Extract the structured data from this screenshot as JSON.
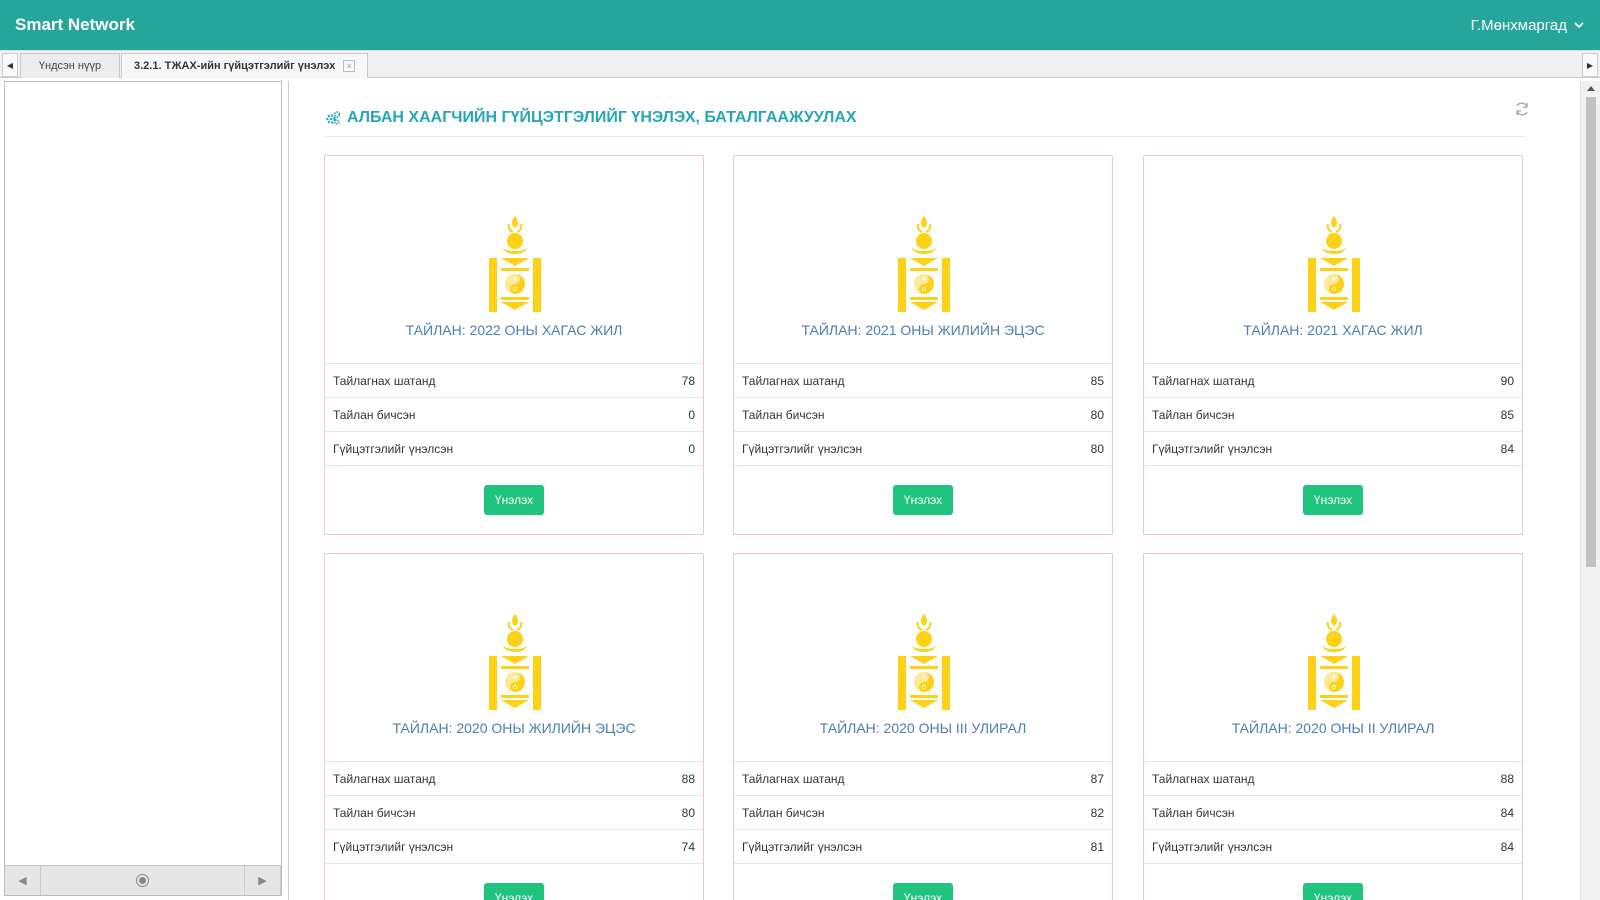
{
  "header": {
    "brand": "Smart Network",
    "user_name": "Г.Мөнхмаргад"
  },
  "tabs": [
    {
      "label": "Үндсэн нүүр"
    },
    {
      "label": "3.2.1. ТЖАХ-ийн гүйцэтгэлийг үнэлэх"
    }
  ],
  "page": {
    "title": "АЛБАН ХААГЧИЙН ГҮЙЦЭТГЭЛИЙГ ҮНЭЛЭХ, БАТАЛГААЖУУЛАХ"
  },
  "labels": {
    "to_report": "Тайлагнах шатанд",
    "written": "Тайлан бичсэн",
    "evaluated": "Гүйцэтгэлийг үнэлсэн",
    "evaluate_button": "Үнэлэх"
  },
  "reports": [
    {
      "title": "ТАЙЛАН: 2022 ОНЫ ХАГАС ЖИЛ",
      "to_report": "78",
      "written": "0",
      "evaluated": "0"
    },
    {
      "title": "ТАЙЛАН: 2021 ОНЫ ЖИЛИЙН ЭЦЭС",
      "to_report": "85",
      "written": "80",
      "evaluated": "80"
    },
    {
      "title": "ТАЙЛАН: 2021 ХАГАС ЖИЛ",
      "to_report": "90",
      "written": "85",
      "evaluated": "84"
    },
    {
      "title": "ТАЙЛАН: 2020 ОНЫ ЖИЛИЙН ЭЦЭС",
      "to_report": "88",
      "written": "80",
      "evaluated": "74"
    },
    {
      "title": "ТАЙЛАН: 2020 ОНЫ III УЛИРАЛ",
      "to_report": "87",
      "written": "82",
      "evaluated": "81"
    },
    {
      "title": "ТАЙЛАН: 2020 ОНЫ II УЛИРАЛ",
      "to_report": "88",
      "written": "84",
      "evaluated": "84"
    }
  ],
  "colors": {
    "header_bg": "#26a69a",
    "title": "#26a6b6",
    "card_title": "#4a7fae",
    "button": "#21c47f",
    "emblem": "#fcd116"
  },
  "icons": {
    "user_menu": "chevron-down-icon",
    "title": "gears-icon",
    "refresh": "refresh-icon",
    "emblem": "soyombo-emblem"
  }
}
